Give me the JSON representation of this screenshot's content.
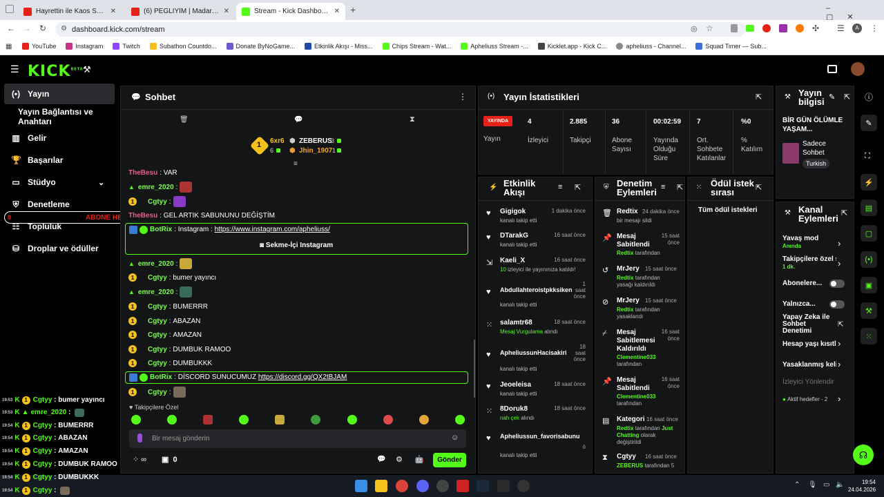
{
  "browser": {
    "tabs": [
      {
        "title": "Hayrettin ile Kaos Show - 2.Sez",
        "color": "#e62117",
        "active": false
      },
      {
        "title": "(6) PEGLIYIM | Madara Olduk #",
        "color": "#e62117",
        "active": false
      },
      {
        "title": "Stream - Kick Dashboard",
        "color": "#53fc18",
        "active": true
      }
    ],
    "url": "dashboard.kick.com/stream",
    "bookmarks": [
      {
        "label": "YouTube",
        "color": "#e62117"
      },
      {
        "label": "Instagram",
        "color": "#c13584"
      },
      {
        "label": "Twitch",
        "color": "#9146ff"
      },
      {
        "label": "Subathon Countdo...",
        "color": "#f5c21b"
      },
      {
        "label": "Donate ByNoGame...",
        "color": "#6b5bd2"
      },
      {
        "label": "Etkinlik Akışı - Miss...",
        "color": "#1f4aa8"
      },
      {
        "label": "Chips Stream - Wat...",
        "color": "#53fc18"
      },
      {
        "label": "Apheliuss Stream -...",
        "color": "#53fc18"
      },
      {
        "label": "Kicklet.app - Kick C...",
        "color": "#444444"
      },
      {
        "label": "apheliuss - Channel...",
        "color": "#888888"
      },
      {
        "label": "Squad Timer — Sub...",
        "color": "#3a6fd8"
      }
    ]
  },
  "brand": {
    "logo": "KICK",
    "beta": "BETA",
    "accent": "#53fc18"
  },
  "sidebar": {
    "items": [
      {
        "label": "Yayın",
        "icon": "live-icon",
        "active": true
      },
      {
        "label": "Yayın Bağlantısı ve Anahtarı",
        "icon": "",
        "active": false
      },
      {
        "label": "Gelir",
        "icon": "chart-icon",
        "active": false
      },
      {
        "label": "Başarılar",
        "icon": "trophy-icon",
        "active": false
      },
      {
        "label": "Stüdyo",
        "icon": "studio-icon",
        "active": false
      },
      {
        "label": "Denetleme",
        "icon": "shield-icon",
        "active": false
      },
      {
        "label": "Topluluk",
        "icon": "community-icon",
        "active": false
      },
      {
        "label": "Droplar ve ödüller",
        "icon": "drops-icon",
        "active": false
      }
    ]
  },
  "overlay_alert": {
    "text": "ABONE HEDEFİ",
    "num": "0"
  },
  "chat": {
    "title": "Sohbet",
    "leaderboard": {
      "top": "6xr6",
      "top_count": "6",
      "second": "ZEBERUS",
      "second_count": "3",
      "third": "Jhin_1907",
      "third_count": "1"
    },
    "messages": [
      {
        "user": "TheBesu",
        "text": "VAR",
        "badge": ""
      },
      {
        "user": "emre_2020",
        "text": "",
        "badge": "triangle"
      },
      {
        "user": "Cgtyy",
        "text": "",
        "badge": "1"
      },
      {
        "user": "TheBesu",
        "text": "GEL ARTIK SABUNUNU DEĞİŞTİM",
        "badge": ""
      },
      {
        "user": "emre_2020",
        "text": "",
        "badge": "triangle"
      },
      {
        "user": "Cgtyy",
        "text": "bumer yayıncı",
        "badge": "1"
      },
      {
        "user": "emre_2020",
        "text": "",
        "badge": "triangle"
      },
      {
        "user": "Cgtyy",
        "text": "BUMERRR",
        "badge": "1"
      },
      {
        "user": "Cgtyy",
        "text": "ABAZAN",
        "badge": "1"
      },
      {
        "user": "Cgtyy",
        "text": "AMAZAN",
        "badge": "1"
      },
      {
        "user": "Cgtyy",
        "text": "DUMBUK RAMOO",
        "badge": "1"
      },
      {
        "user": "Cgtyy",
        "text": "DUMBUKKK",
        "badge": "1"
      },
      {
        "user": "Cgtyy",
        "text": "",
        "badge": "1"
      }
    ],
    "bot1": {
      "user": "BotRix",
      "text": "Instagram : ",
      "link": "https://www.instagram.com/apheliuss/",
      "button": "Sekme-İçi Instagram"
    },
    "bot2": {
      "user": "BotRix",
      "text": "DİSCORD SUNUCUMUZ ",
      "link": "https://discord.gg/QX2tBJAM"
    },
    "emote_section": "Takipçilere Özel",
    "input_placeholder": "Bir mesaj gönderin",
    "points": "∞",
    "gift_count": "0",
    "send_label": "Gönder"
  },
  "stats": {
    "title": "Yayın İstatistikleri",
    "live_badge": "YAYINDA",
    "live_label": "Yayın",
    "items": [
      {
        "value": "4",
        "label": "İzleyici"
      },
      {
        "value": "2.885",
        "label": "Takipçi"
      },
      {
        "value": "36",
        "label": "Abone Sayısı"
      },
      {
        "value": "00:02:59",
        "label": "Yayında Olduğu Süre"
      },
      {
        "value": "7",
        "label": "Ort. Sohbete Katılanlar"
      },
      {
        "value": "%0",
        "label": "% Katılım"
      }
    ]
  },
  "activity": {
    "title": "Etkinlik Akışı",
    "items": [
      {
        "name": "Gigigok",
        "time": "1 dakika önce",
        "sub": "kanalı takip etti",
        "icon": "heart-icon"
      },
      {
        "name": "DTarakG",
        "time": "16 saat önce",
        "sub": "kanalı takip etti",
        "icon": "heart-icon"
      },
      {
        "name": "Kaeli_X",
        "time": "16 saat önce",
        "sub": "izleyici ile yayınınıza katıldı!",
        "sub_green": "10",
        "icon": "raid-icon"
      },
      {
        "name": "Abdullahteroistpkksiken",
        "time": "1 saat önce",
        "sub": "kanalı takip etti",
        "icon": "heart-icon"
      },
      {
        "name": "salamtr68",
        "time": "18 saat önce",
        "sub": "alındı",
        "sub_green": "Mesaj Vurgulama",
        "icon": "reward-icon"
      },
      {
        "name": "ApheliussunHacisakiri",
        "time": "18 saat önce",
        "sub": "kanalı takip etti",
        "icon": "heart-icon"
      },
      {
        "name": "Jeoeleisa",
        "time": "18 saat önce",
        "sub": "kanalı takip etti",
        "icon": "heart-icon"
      },
      {
        "name": "8Doruk8",
        "time": "18 saat önce",
        "sub": "alındı",
        "sub_green": "nah çek",
        "icon": "reward-icon"
      },
      {
        "name": "Apheliussun_favorisabunu",
        "time": "ö",
        "sub": "kanalı takip etti",
        "icon": "heart-icon"
      }
    ]
  },
  "moderation": {
    "title": "Denetim Eylemleri",
    "items": [
      {
        "name": "Redtix",
        "time": "24 dakika önce",
        "sub": "bir mesajı sildi",
        "icon": "trash-icon"
      },
      {
        "name": "Mesaj Sabitlendi",
        "time": "15 saat önce",
        "green": "Redtix",
        "sub": "tarafından",
        "icon": "pin-icon"
      },
      {
        "name": "MrJery",
        "time": "15 saat önce",
        "green": "Redtix",
        "sub": "tarafından yasağı kaldırıldı",
        "icon": "unban-icon"
      },
      {
        "name": "MrJery",
        "time": "15 saat önce",
        "green": "Redtix",
        "sub": "tarafından yasaklandı",
        "icon": "ban-icon"
      },
      {
        "name": "Mesaj Sabitlemesi Kaldırıldı",
        "time": "16 saat önce",
        "green": "Clementine033",
        "sub": "tarafından",
        "icon": "unpin-icon"
      },
      {
        "name": "Mesaj Sabitlendi",
        "time": "16 saat önce",
        "green": "Clementine033",
        "sub": "tarafından",
        "icon": "pin-icon"
      },
      {
        "name": "Kategori",
        "time": "16 saat önce",
        "green": "Redtix",
        "sub": "tarafından",
        "green2": "Just Chatting",
        "sub2": "olarak değiştirildi",
        "icon": "category-icon"
      },
      {
        "name": "Cgtyy",
        "time": "16 saat önce",
        "green": "ZEBERUS",
        "sub": "tarafından 5",
        "icon": "timeout-icon"
      }
    ]
  },
  "rewards": {
    "title": "Ödül istek sırası",
    "all": "Tüm ödül istekleri"
  },
  "stream_info": {
    "title": "Yayın bilgisi",
    "stream_title": "BİR GÜN ÖLÜMLE YAŞAM...",
    "category": "Sadece Sohbet",
    "language": "Turkish"
  },
  "channel_actions": {
    "title": "Kanal Eylemleri",
    "slow_mode": "Yavaş mod",
    "slow_mode_value": "Anında",
    "followers_only": "Takipçilere özel s",
    "followers_value": "1 dk.",
    "subscribers": "Abonelere...",
    "only": "Yalnızca...",
    "ai_mod": "Yapay Zeka ile Sohbet Denetimi",
    "account_age": "Hesap yaşı kısıtl",
    "banned_words": "Yasaklanmış keli",
    "viewer_direction": "İzleyici Yönlendir",
    "active_goals": "Aktif hedefler - 2"
  },
  "stream_overlay_chat": [
    {
      "time": "19:53",
      "user": "Cgtyy",
      "text": "bumer yayıncı"
    },
    {
      "time": "19:53",
      "user": "emre_2020",
      "text": ""
    },
    {
      "time": "19:54",
      "user": "Cgtyy",
      "text": "BUMERRR"
    },
    {
      "time": "19:54",
      "user": "Cgtyy",
      "text": "ABAZAN"
    },
    {
      "time": "19:54",
      "user": "Cgtyy",
      "text": "AMAZAN"
    },
    {
      "time": "19:54",
      "user": "Cgtyy",
      "text": "DUMBUK RAMOO"
    },
    {
      "time": "19:54",
      "user": "Cgtyy",
      "text": "DUMBUKKK"
    },
    {
      "time": "19:54",
      "user": "Cgtyy",
      "text": ""
    }
  ],
  "taskbar": {
    "time": "19:54",
    "date": "24.04.2026"
  }
}
